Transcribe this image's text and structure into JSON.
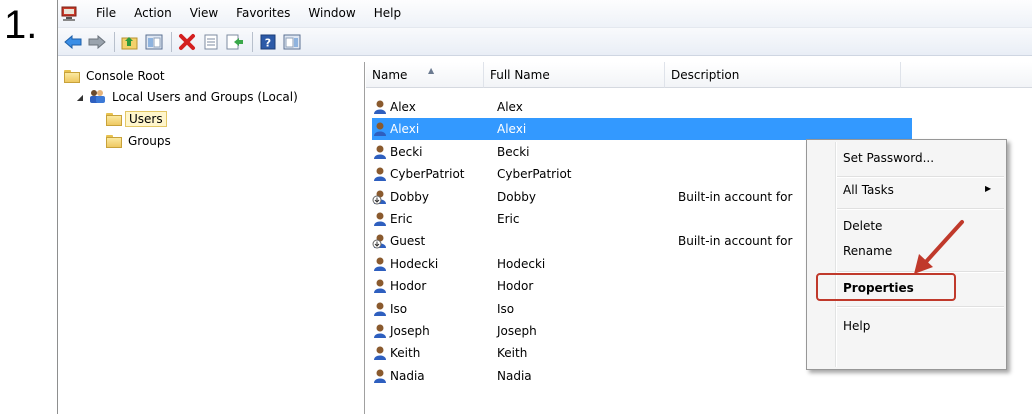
{
  "step_label": "1.",
  "menubar": {
    "items": [
      "File",
      "Action",
      "View",
      "Favorites",
      "Window",
      "Help"
    ]
  },
  "toolbar": {
    "buttons": [
      "back-icon",
      "forward-icon",
      "up-folder-icon",
      "show-hide-tree-icon",
      "delete-icon",
      "properties-icon",
      "export-list-icon",
      "help-icon",
      "show-hide-action-pane-icon"
    ]
  },
  "tree": {
    "root": "Console Root",
    "group": "Local Users and Groups (Local)",
    "users": "Users",
    "groups": "Groups"
  },
  "list": {
    "columns": {
      "name": "Name",
      "full_name": "Full Name",
      "description": "Description"
    },
    "rows": [
      {
        "name": "Alex",
        "full_name": "Alex",
        "description": "",
        "disabled": false
      },
      {
        "name": "Alexi",
        "full_name": "Alexi",
        "description": "",
        "disabled": false,
        "selected": true
      },
      {
        "name": "Becki",
        "full_name": "Becki",
        "description": "",
        "disabled": false
      },
      {
        "name": "CyberPatriot",
        "full_name": "CyberPatriot",
        "description": "",
        "disabled": false
      },
      {
        "name": "Dobby",
        "full_name": "Dobby",
        "description": "Built-in account for",
        "disabled": true
      },
      {
        "name": "Eric",
        "full_name": "Eric",
        "description": "",
        "disabled": false
      },
      {
        "name": "Guest",
        "full_name": "",
        "description": "Built-in account for",
        "disabled": true
      },
      {
        "name": "Hodecki",
        "full_name": "Hodecki",
        "description": "",
        "disabled": false
      },
      {
        "name": "Hodor",
        "full_name": "Hodor",
        "description": "",
        "disabled": false
      },
      {
        "name": "Iso",
        "full_name": "Iso",
        "description": "",
        "disabled": false
      },
      {
        "name": "Joseph",
        "full_name": "Joseph",
        "description": "",
        "disabled": false
      },
      {
        "name": "Keith",
        "full_name": "Keith",
        "description": "",
        "disabled": false
      },
      {
        "name": "Nadia",
        "full_name": "Nadia",
        "description": "",
        "disabled": false
      }
    ]
  },
  "context_menu": {
    "set_password": "Set Password...",
    "all_tasks": "All Tasks",
    "delete": "Delete",
    "rename": "Rename",
    "properties": "Properties",
    "help": "Help"
  },
  "colors": {
    "selection": "#3399ff",
    "annotation": "#c0392b"
  }
}
